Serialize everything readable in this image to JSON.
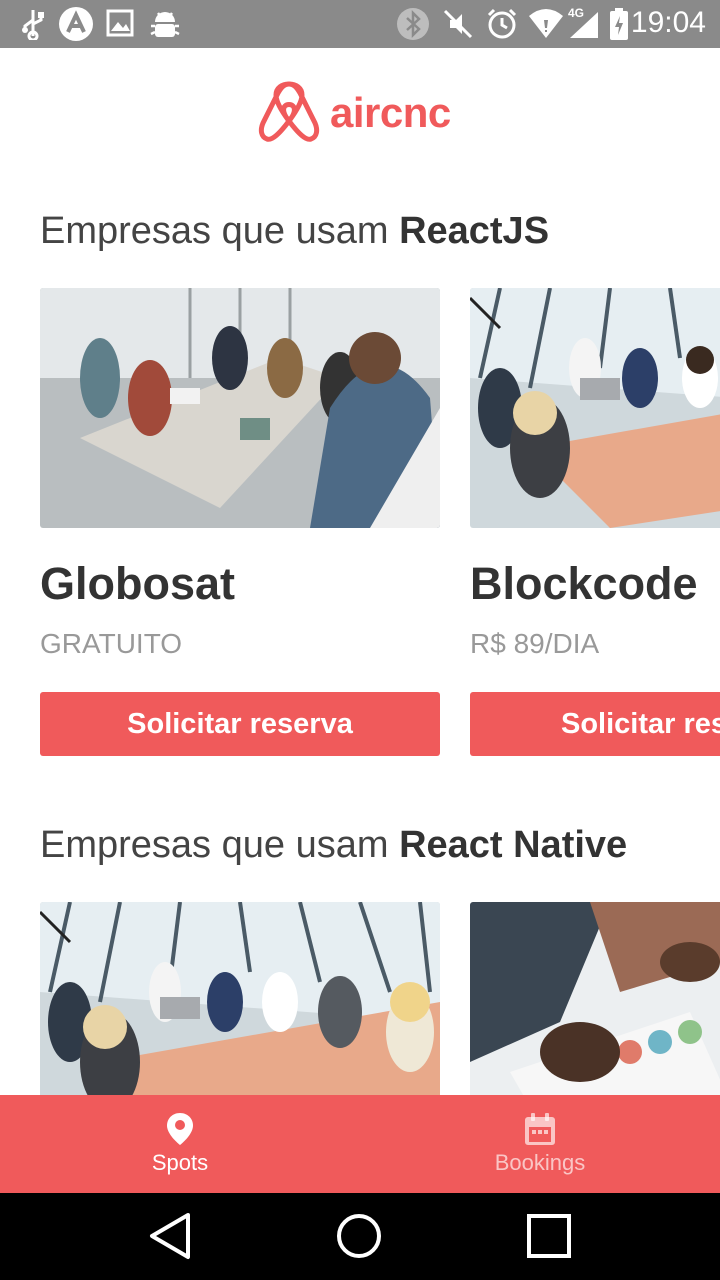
{
  "status_bar": {
    "time": "19:04",
    "network": "4G",
    "left_icons": [
      "usb-icon",
      "app-notification-icon",
      "image-icon",
      "android-debug-icon"
    ],
    "right_icons": [
      "bluetooth-icon",
      "mute-icon",
      "alarm-icon",
      "wifi-icon",
      "signal-icon",
      "battery-icon"
    ]
  },
  "header": {
    "logo_text": "aircnc"
  },
  "sections": [
    {
      "title_prefix": "Empresas que usam ",
      "title_tech": "ReactJS",
      "cards": [
        {
          "name": "Globosat",
          "price": "GRATUITO",
          "button": "Solicitar reserva"
        },
        {
          "name": "Blockcode",
          "price": "R$ 89/DIA",
          "button": "Solicitar reserva"
        }
      ]
    },
    {
      "title_prefix": "Empresas que usam ",
      "title_tech": "React Native",
      "cards": [
        {
          "name": "",
          "price": "",
          "button": ""
        },
        {
          "name": "",
          "price": "",
          "button": ""
        }
      ]
    }
  ],
  "tabbar": {
    "tabs": [
      {
        "label": "Spots",
        "icon": "map-pin-icon",
        "active": true
      },
      {
        "label": "Bookings",
        "icon": "calendar-icon",
        "active": false
      }
    ]
  },
  "nav_bar": {
    "buttons": [
      "back-icon",
      "home-icon",
      "recents-icon"
    ]
  },
  "colors": {
    "accent": "#F05A5B",
    "title": "#444444",
    "price": "#999999",
    "status_bar": "#8a8a8a"
  }
}
